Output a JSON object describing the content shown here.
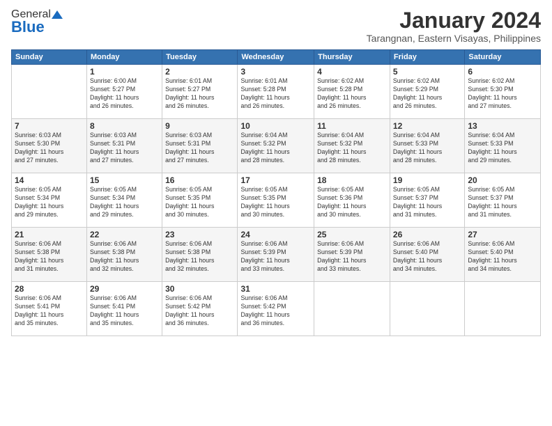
{
  "logo": {
    "general": "General",
    "blue": "Blue"
  },
  "header": {
    "month": "January 2024",
    "location": "Tarangnan, Eastern Visayas, Philippines"
  },
  "days_of_week": [
    "Sunday",
    "Monday",
    "Tuesday",
    "Wednesday",
    "Thursday",
    "Friday",
    "Saturday"
  ],
  "weeks": [
    [
      {
        "day": "",
        "info": ""
      },
      {
        "day": "1",
        "info": "Sunrise: 6:00 AM\nSunset: 5:27 PM\nDaylight: 11 hours\nand 26 minutes."
      },
      {
        "day": "2",
        "info": "Sunrise: 6:01 AM\nSunset: 5:27 PM\nDaylight: 11 hours\nand 26 minutes."
      },
      {
        "day": "3",
        "info": "Sunrise: 6:01 AM\nSunset: 5:28 PM\nDaylight: 11 hours\nand 26 minutes."
      },
      {
        "day": "4",
        "info": "Sunrise: 6:02 AM\nSunset: 5:28 PM\nDaylight: 11 hours\nand 26 minutes."
      },
      {
        "day": "5",
        "info": "Sunrise: 6:02 AM\nSunset: 5:29 PM\nDaylight: 11 hours\nand 26 minutes."
      },
      {
        "day": "6",
        "info": "Sunrise: 6:02 AM\nSunset: 5:30 PM\nDaylight: 11 hours\nand 27 minutes."
      }
    ],
    [
      {
        "day": "7",
        "info": "Sunrise: 6:03 AM\nSunset: 5:30 PM\nDaylight: 11 hours\nand 27 minutes."
      },
      {
        "day": "8",
        "info": "Sunrise: 6:03 AM\nSunset: 5:31 PM\nDaylight: 11 hours\nand 27 minutes."
      },
      {
        "day": "9",
        "info": "Sunrise: 6:03 AM\nSunset: 5:31 PM\nDaylight: 11 hours\nand 27 minutes."
      },
      {
        "day": "10",
        "info": "Sunrise: 6:04 AM\nSunset: 5:32 PM\nDaylight: 11 hours\nand 28 minutes."
      },
      {
        "day": "11",
        "info": "Sunrise: 6:04 AM\nSunset: 5:32 PM\nDaylight: 11 hours\nand 28 minutes."
      },
      {
        "day": "12",
        "info": "Sunrise: 6:04 AM\nSunset: 5:33 PM\nDaylight: 11 hours\nand 28 minutes."
      },
      {
        "day": "13",
        "info": "Sunrise: 6:04 AM\nSunset: 5:33 PM\nDaylight: 11 hours\nand 29 minutes."
      }
    ],
    [
      {
        "day": "14",
        "info": "Sunrise: 6:05 AM\nSunset: 5:34 PM\nDaylight: 11 hours\nand 29 minutes."
      },
      {
        "day": "15",
        "info": "Sunrise: 6:05 AM\nSunset: 5:34 PM\nDaylight: 11 hours\nand 29 minutes."
      },
      {
        "day": "16",
        "info": "Sunrise: 6:05 AM\nSunset: 5:35 PM\nDaylight: 11 hours\nand 30 minutes."
      },
      {
        "day": "17",
        "info": "Sunrise: 6:05 AM\nSunset: 5:35 PM\nDaylight: 11 hours\nand 30 minutes."
      },
      {
        "day": "18",
        "info": "Sunrise: 6:05 AM\nSunset: 5:36 PM\nDaylight: 11 hours\nand 30 minutes."
      },
      {
        "day": "19",
        "info": "Sunrise: 6:05 AM\nSunset: 5:37 PM\nDaylight: 11 hours\nand 31 minutes."
      },
      {
        "day": "20",
        "info": "Sunrise: 6:05 AM\nSunset: 5:37 PM\nDaylight: 11 hours\nand 31 minutes."
      }
    ],
    [
      {
        "day": "21",
        "info": "Sunrise: 6:06 AM\nSunset: 5:38 PM\nDaylight: 11 hours\nand 31 minutes."
      },
      {
        "day": "22",
        "info": "Sunrise: 6:06 AM\nSunset: 5:38 PM\nDaylight: 11 hours\nand 32 minutes."
      },
      {
        "day": "23",
        "info": "Sunrise: 6:06 AM\nSunset: 5:38 PM\nDaylight: 11 hours\nand 32 minutes."
      },
      {
        "day": "24",
        "info": "Sunrise: 6:06 AM\nSunset: 5:39 PM\nDaylight: 11 hours\nand 33 minutes."
      },
      {
        "day": "25",
        "info": "Sunrise: 6:06 AM\nSunset: 5:39 PM\nDaylight: 11 hours\nand 33 minutes."
      },
      {
        "day": "26",
        "info": "Sunrise: 6:06 AM\nSunset: 5:40 PM\nDaylight: 11 hours\nand 34 minutes."
      },
      {
        "day": "27",
        "info": "Sunrise: 6:06 AM\nSunset: 5:40 PM\nDaylight: 11 hours\nand 34 minutes."
      }
    ],
    [
      {
        "day": "28",
        "info": "Sunrise: 6:06 AM\nSunset: 5:41 PM\nDaylight: 11 hours\nand 35 minutes."
      },
      {
        "day": "29",
        "info": "Sunrise: 6:06 AM\nSunset: 5:41 PM\nDaylight: 11 hours\nand 35 minutes."
      },
      {
        "day": "30",
        "info": "Sunrise: 6:06 AM\nSunset: 5:42 PM\nDaylight: 11 hours\nand 36 minutes."
      },
      {
        "day": "31",
        "info": "Sunrise: 6:06 AM\nSunset: 5:42 PM\nDaylight: 11 hours\nand 36 minutes."
      },
      {
        "day": "",
        "info": ""
      },
      {
        "day": "",
        "info": ""
      },
      {
        "day": "",
        "info": ""
      }
    ]
  ]
}
